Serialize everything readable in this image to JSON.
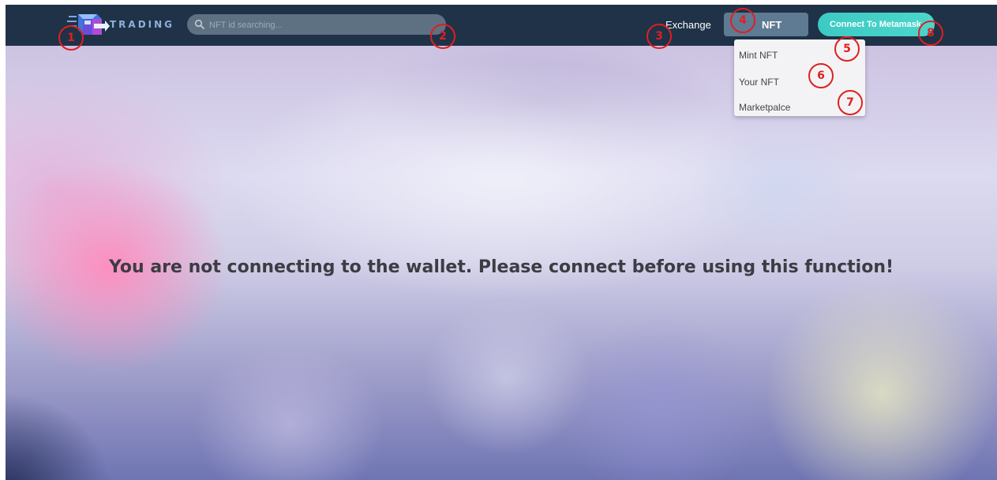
{
  "brand": {
    "logo_text": "TRADING"
  },
  "search": {
    "placeholder": "NFT id searching..."
  },
  "nav": {
    "exchange_label": "Exchange",
    "nft_label": "NFT",
    "connect_label": "Connect To Metamask"
  },
  "dropdown": {
    "items": [
      {
        "label": "Mint NFT"
      },
      {
        "label": "Your NFT"
      },
      {
        "label": "Marketpalce"
      }
    ]
  },
  "main": {
    "message": "You are not connecting to the wallet. Please connect before using this function!"
  },
  "annotations": [
    "1",
    "2",
    "3",
    "4",
    "5",
    "6",
    "7",
    "8"
  ],
  "colors": {
    "navbar": "#1f3248",
    "search_bg": "#5e7183",
    "nft_button": "#5f7a93",
    "connect_button": "#3ccac3",
    "annotation": "#e01f1f"
  },
  "icons": {
    "logo": "trading-box-logo-icon",
    "search": "search-icon"
  }
}
